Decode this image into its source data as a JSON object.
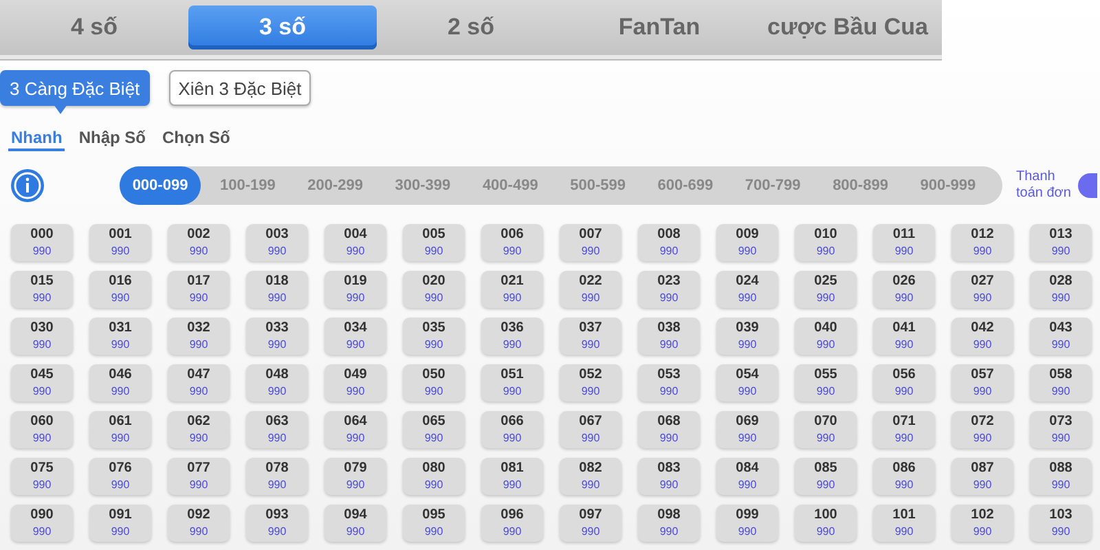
{
  "game_tabs": [
    {
      "label": "4 số",
      "selected": false
    },
    {
      "label": "3 số",
      "selected": true
    },
    {
      "label": "2 số",
      "selected": false
    },
    {
      "label": "FanTan",
      "selected": false
    },
    {
      "label": "cược Bầu Cua",
      "selected": false
    }
  ],
  "bet_types": [
    {
      "label": "3 Càng Đặc Biệt",
      "selected": true
    },
    {
      "label": "Xiên 3 Đặc Biệt",
      "selected": false
    }
  ],
  "modes": [
    {
      "label": "Nhanh",
      "selected": true
    },
    {
      "label": "Nhập Số",
      "selected": false
    },
    {
      "label": "Chọn Số",
      "selected": false
    }
  ],
  "ranges": [
    {
      "label": "000-099",
      "selected": true
    },
    {
      "label": "100-199",
      "selected": false
    },
    {
      "label": "200-299",
      "selected": false
    },
    {
      "label": "300-399",
      "selected": false
    },
    {
      "label": "400-499",
      "selected": false
    },
    {
      "label": "500-599",
      "selected": false
    },
    {
      "label": "600-699",
      "selected": false
    },
    {
      "label": "700-799",
      "selected": false
    },
    {
      "label": "800-899",
      "selected": false
    },
    {
      "label": "900-999",
      "selected": false
    }
  ],
  "pay_label": "Thanh toán đơn",
  "pay_toggle_on": true,
  "number_rows": [
    [
      {
        "number": "000",
        "price": "990"
      },
      {
        "number": "001",
        "price": "990"
      },
      {
        "number": "002",
        "price": "990"
      },
      {
        "number": "003",
        "price": "990"
      },
      {
        "number": "004",
        "price": "990"
      },
      {
        "number": "005",
        "price": "990"
      },
      {
        "number": "006",
        "price": "990"
      },
      {
        "number": "007",
        "price": "990"
      },
      {
        "number": "008",
        "price": "990"
      },
      {
        "number": "009",
        "price": "990"
      },
      {
        "number": "010",
        "price": "990"
      },
      {
        "number": "011",
        "price": "990"
      },
      {
        "number": "012",
        "price": "990"
      },
      {
        "number": "013",
        "price": "990"
      }
    ],
    [
      {
        "number": "015",
        "price": "990"
      },
      {
        "number": "016",
        "price": "990"
      },
      {
        "number": "017",
        "price": "990"
      },
      {
        "number": "018",
        "price": "990"
      },
      {
        "number": "019",
        "price": "990"
      },
      {
        "number": "020",
        "price": "990"
      },
      {
        "number": "021",
        "price": "990"
      },
      {
        "number": "022",
        "price": "990"
      },
      {
        "number": "023",
        "price": "990"
      },
      {
        "number": "024",
        "price": "990"
      },
      {
        "number": "025",
        "price": "990"
      },
      {
        "number": "026",
        "price": "990"
      },
      {
        "number": "027",
        "price": "990"
      },
      {
        "number": "028",
        "price": "990"
      }
    ],
    [
      {
        "number": "030",
        "price": "990"
      },
      {
        "number": "031",
        "price": "990"
      },
      {
        "number": "032",
        "price": "990"
      },
      {
        "number": "033",
        "price": "990"
      },
      {
        "number": "034",
        "price": "990"
      },
      {
        "number": "035",
        "price": "990"
      },
      {
        "number": "036",
        "price": "990"
      },
      {
        "number": "037",
        "price": "990"
      },
      {
        "number": "038",
        "price": "990"
      },
      {
        "number": "039",
        "price": "990"
      },
      {
        "number": "040",
        "price": "990"
      },
      {
        "number": "041",
        "price": "990"
      },
      {
        "number": "042",
        "price": "990"
      },
      {
        "number": "043",
        "price": "990"
      }
    ],
    [
      {
        "number": "045",
        "price": "990"
      },
      {
        "number": "046",
        "price": "990"
      },
      {
        "number": "047",
        "price": "990"
      },
      {
        "number": "048",
        "price": "990"
      },
      {
        "number": "049",
        "price": "990"
      },
      {
        "number": "050",
        "price": "990"
      },
      {
        "number": "051",
        "price": "990"
      },
      {
        "number": "052",
        "price": "990"
      },
      {
        "number": "053",
        "price": "990"
      },
      {
        "number": "054",
        "price": "990"
      },
      {
        "number": "055",
        "price": "990"
      },
      {
        "number": "056",
        "price": "990"
      },
      {
        "number": "057",
        "price": "990"
      },
      {
        "number": "058",
        "price": "990"
      }
    ],
    [
      {
        "number": "060",
        "price": "990"
      },
      {
        "number": "061",
        "price": "990"
      },
      {
        "number": "062",
        "price": "990"
      },
      {
        "number": "063",
        "price": "990"
      },
      {
        "number": "064",
        "price": "990"
      },
      {
        "number": "065",
        "price": "990"
      },
      {
        "number": "066",
        "price": "990"
      },
      {
        "number": "067",
        "price": "990"
      },
      {
        "number": "068",
        "price": "990"
      },
      {
        "number": "069",
        "price": "990"
      },
      {
        "number": "070",
        "price": "990"
      },
      {
        "number": "071",
        "price": "990"
      },
      {
        "number": "072",
        "price": "990"
      },
      {
        "number": "073",
        "price": "990"
      }
    ],
    [
      {
        "number": "075",
        "price": "990"
      },
      {
        "number": "076",
        "price": "990"
      },
      {
        "number": "077",
        "price": "990"
      },
      {
        "number": "078",
        "price": "990"
      },
      {
        "number": "079",
        "price": "990"
      },
      {
        "number": "080",
        "price": "990"
      },
      {
        "number": "081",
        "price": "990"
      },
      {
        "number": "082",
        "price": "990"
      },
      {
        "number": "083",
        "price": "990"
      },
      {
        "number": "084",
        "price": "990"
      },
      {
        "number": "085",
        "price": "990"
      },
      {
        "number": "086",
        "price": "990"
      },
      {
        "number": "087",
        "price": "990"
      },
      {
        "number": "088",
        "price": "990"
      }
    ],
    [
      {
        "number": "090",
        "price": "990"
      },
      {
        "number": "091",
        "price": "990"
      },
      {
        "number": "092",
        "price": "990"
      },
      {
        "number": "093",
        "price": "990"
      },
      {
        "number": "094",
        "price": "990"
      },
      {
        "number": "095",
        "price": "990"
      },
      {
        "number": "096",
        "price": "990"
      },
      {
        "number": "097",
        "price": "990"
      },
      {
        "number": "098",
        "price": "990"
      },
      {
        "number": "099",
        "price": "990"
      },
      {
        "number": "100",
        "price": "990"
      },
      {
        "number": "101",
        "price": "990"
      },
      {
        "number": "102",
        "price": "990"
      },
      {
        "number": "103",
        "price": "990"
      }
    ]
  ]
}
